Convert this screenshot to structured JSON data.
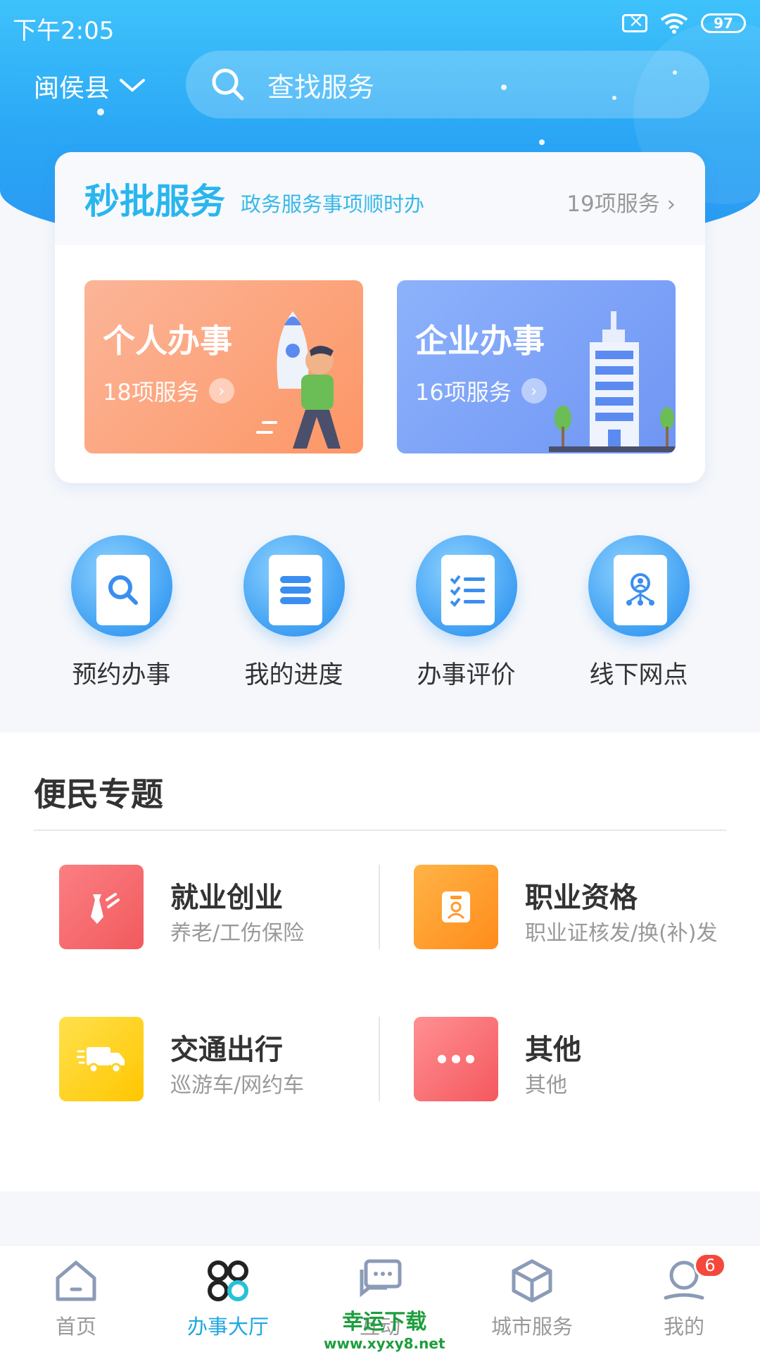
{
  "status_bar": {
    "time": "下午2:05",
    "battery": "97"
  },
  "header": {
    "location": "闽侯县",
    "search_placeholder": "查找服务"
  },
  "card": {
    "title": "秒批服务",
    "subtitle": "政务服务事项顺时办",
    "more": "19项服务",
    "tiles": [
      {
        "title": "个人办事",
        "count": "18项服务"
      },
      {
        "title": "企业办事",
        "count": "16项服务"
      }
    ]
  },
  "quick_actions": [
    {
      "label": "预约办事",
      "icon": "search-doc-icon"
    },
    {
      "label": "我的进度",
      "icon": "progress-doc-icon"
    },
    {
      "label": "办事评价",
      "icon": "checklist-doc-icon"
    },
    {
      "label": "线下网点",
      "icon": "network-doc-icon"
    }
  ],
  "topics": {
    "title": "便民专题",
    "items": [
      {
        "title": "就业创业",
        "sub": "养老/工伤保险",
        "icon": "tie-icon",
        "color": "#f7676a"
      },
      {
        "title": "职业资格",
        "sub": "职业证核发/换(补)发",
        "icon": "badge-icon",
        "color": "#ff9a2a"
      },
      {
        "title": "交通出行",
        "sub": "巡游车/网约车",
        "icon": "truck-icon",
        "color": "#ffd21f"
      },
      {
        "title": "其他",
        "sub": "其他",
        "icon": "more-icon",
        "color": "#fb6f74"
      }
    ]
  },
  "tabbar": {
    "items": [
      {
        "label": "首页",
        "icon": "home-icon"
      },
      {
        "label": "办事大厅",
        "icon": "grid-icon"
      },
      {
        "label": "互动",
        "icon": "chat-icon"
      },
      {
        "label": "城市服务",
        "icon": "cube-icon"
      },
      {
        "label": "我的",
        "icon": "user-icon"
      }
    ],
    "active": "办事大厅",
    "badge": "6"
  },
  "watermark": {
    "line1": "幸运下载",
    "line2": "www.xyxy8.net"
  },
  "colors": {
    "accent": "#1fa7e0",
    "header": "#2aa6f5"
  }
}
